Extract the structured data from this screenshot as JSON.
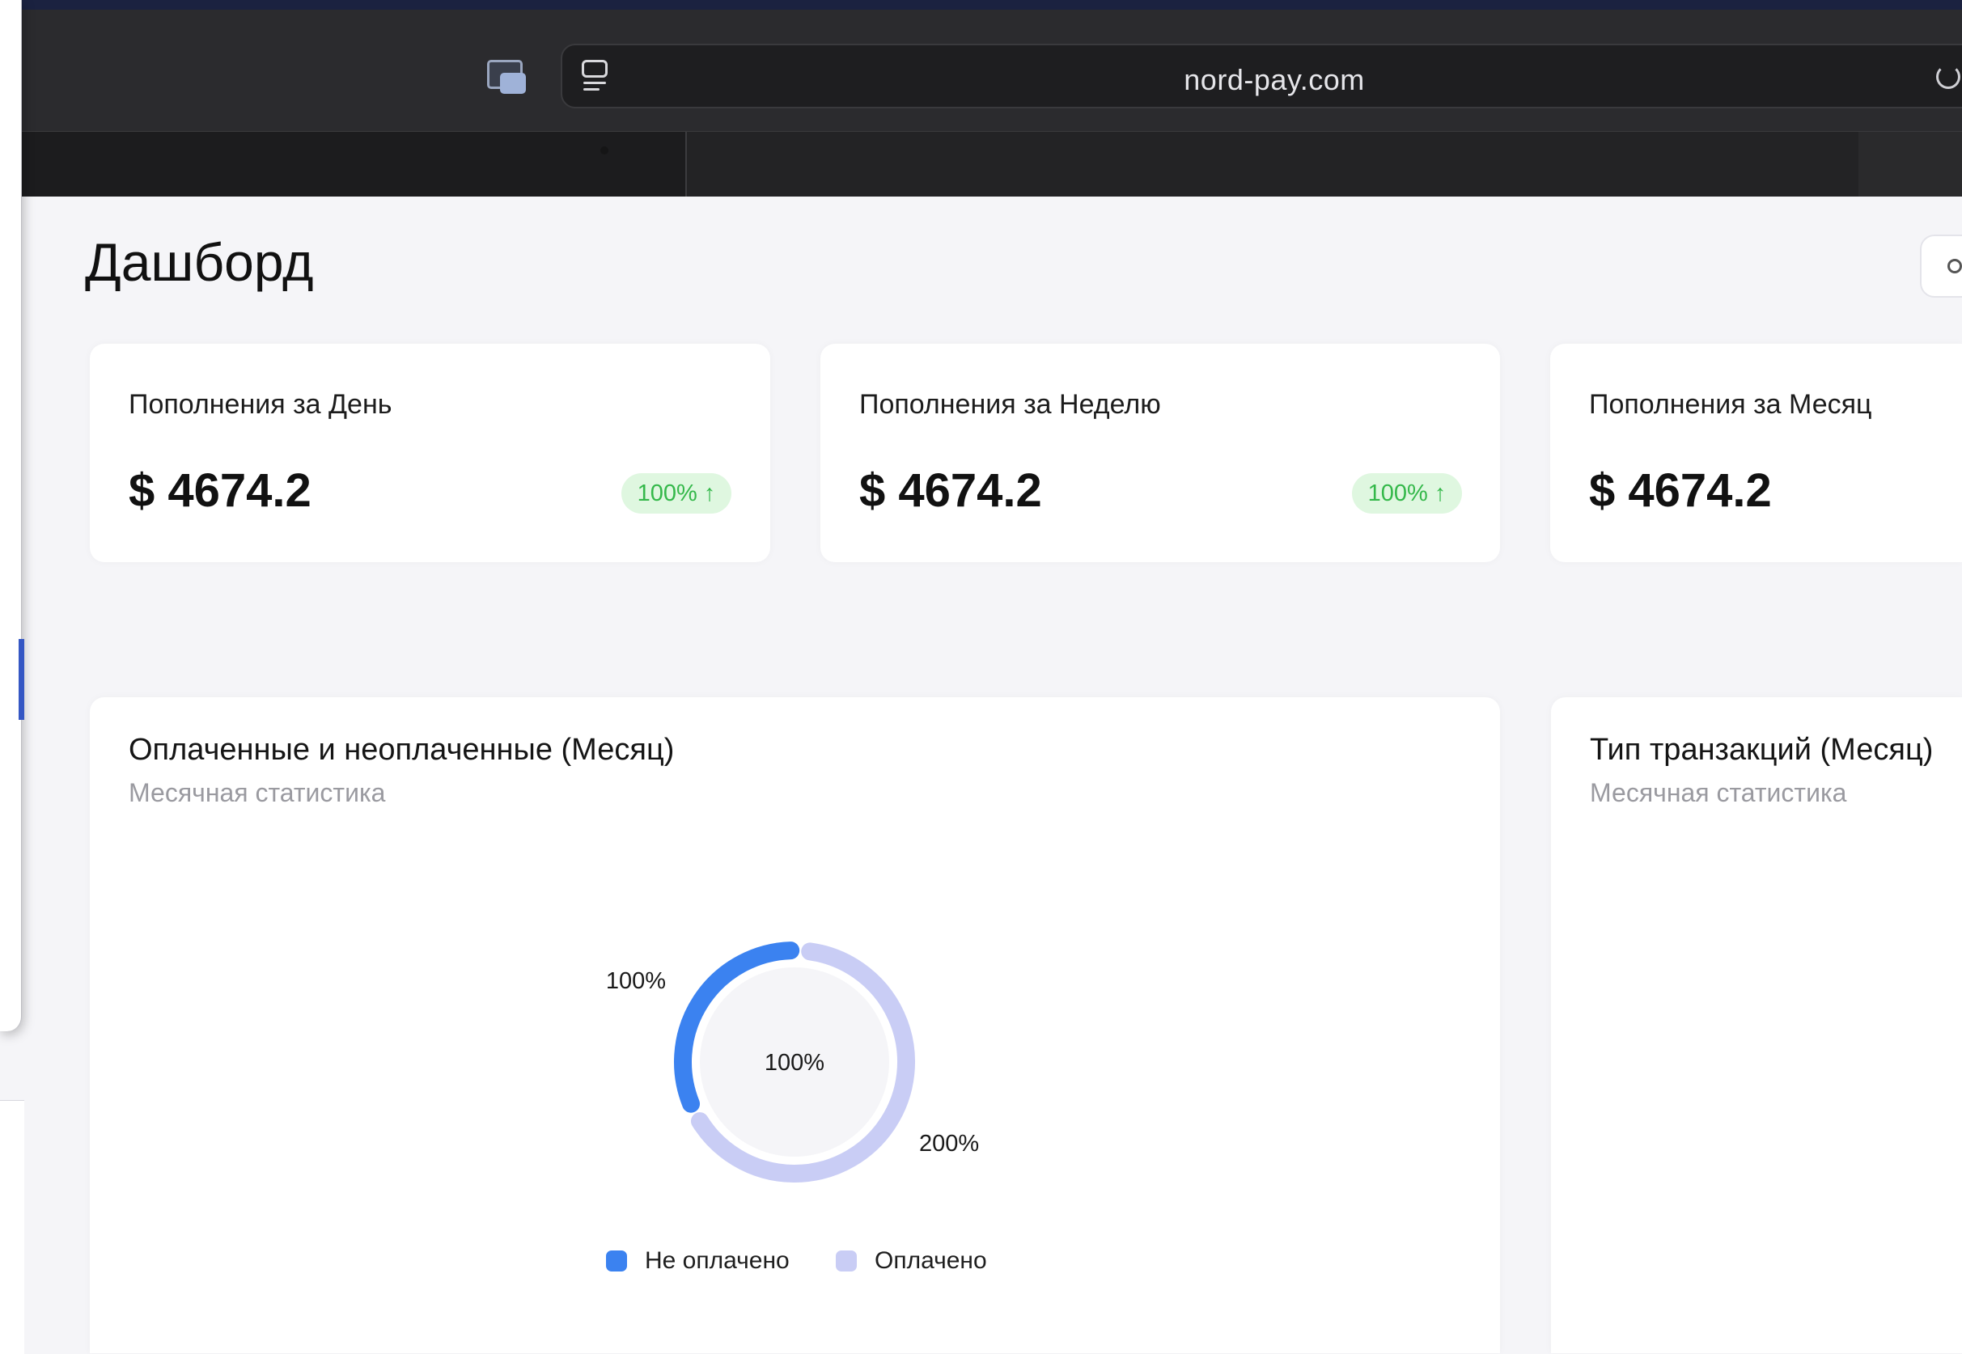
{
  "browser": {
    "url": "nord-pay.com"
  },
  "page": {
    "title": "Дашборд"
  },
  "stats": [
    {
      "label": "Пополнения за День",
      "value": "$ 4674.2",
      "badge": "100% ↑"
    },
    {
      "label": "Пополнения за Неделю",
      "value": "$ 4674.2",
      "badge": "100% ↑"
    },
    {
      "label": "Пополнения за Месяц",
      "value": "$ 4674.2"
    }
  ],
  "paid_chart": {
    "title": "Оплаченные и неоплаченные (Месяц)",
    "subtitle": "Месячная статистика",
    "center_label": "100%",
    "label_unpaid": "100%",
    "label_paid": "200%",
    "legend": [
      {
        "name": "Не оплачено",
        "color": "#3b82f0"
      },
      {
        "name": "Оплачено",
        "color": "#c9cdf5"
      }
    ]
  },
  "type_chart": {
    "title": "Тип транзакций (Месяц)",
    "subtitle": "Месячная статистика"
  },
  "chart_data": {
    "type": "pie",
    "categories": [
      "Не оплачено",
      "Оплачено"
    ],
    "values": [
      1,
      2
    ],
    "data_labels": [
      "100%",
      "200%"
    ],
    "center_label": "100%",
    "legend": "bottom"
  },
  "colors": {
    "unpaid": "#3b82f0",
    "paid": "#c9cdf5",
    "badge_bg": "#dff7e0",
    "badge_text": "#34b84a"
  }
}
